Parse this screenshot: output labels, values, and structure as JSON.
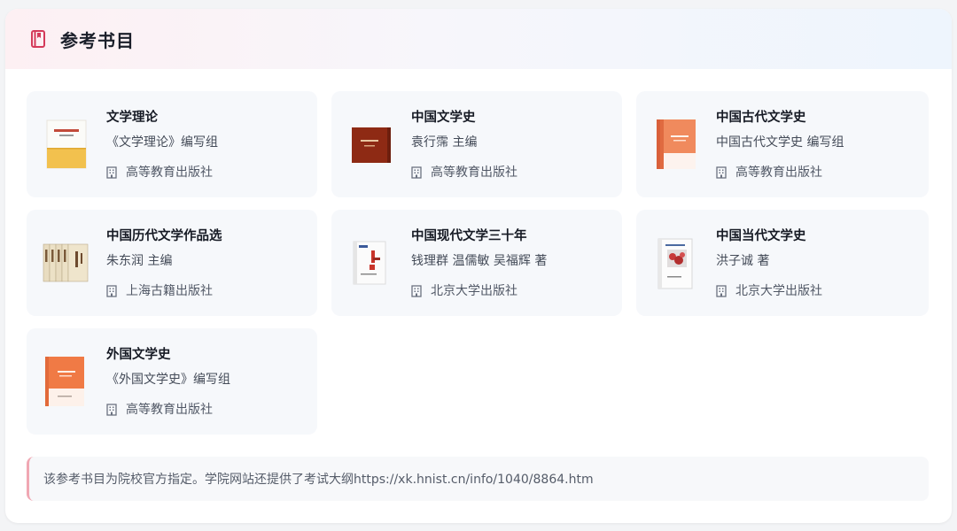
{
  "header": {
    "title": "参考书目",
    "icon": "book-icon",
    "accent_color": "#d43a5a"
  },
  "books": [
    {
      "title": "文学理论",
      "author": "《文学理论》编写组",
      "publisher": "高等教育出版社"
    },
    {
      "title": "中国文学史",
      "author": "袁行霈 主编",
      "publisher": "高等教育出版社"
    },
    {
      "title": "中国古代文学史",
      "author": "中国古代文学史 编写组",
      "publisher": "高等教育出版社"
    },
    {
      "title": "中国历代文学作品选",
      "author": "朱东润 主编",
      "publisher": "上海古籍出版社"
    },
    {
      "title": "中国现代文学三十年",
      "author": "钱理群 温儒敏 吴福辉 著",
      "publisher": "北京大学出版社"
    },
    {
      "title": "中国当代文学史",
      "author": "洪子诚 著",
      "publisher": "北京大学出版社"
    },
    {
      "title": "外国文学史",
      "author": "《外国文学史》编写组",
      "publisher": "高等教育出版社"
    }
  ],
  "publisher_icon": "building-icon",
  "note": {
    "text": "该参考书目为院校官方指定。学院网站还提供了考试大纲https://xk.hnist.cn/info/1040/8864.htm",
    "border_color": "#f0a7b3"
  }
}
